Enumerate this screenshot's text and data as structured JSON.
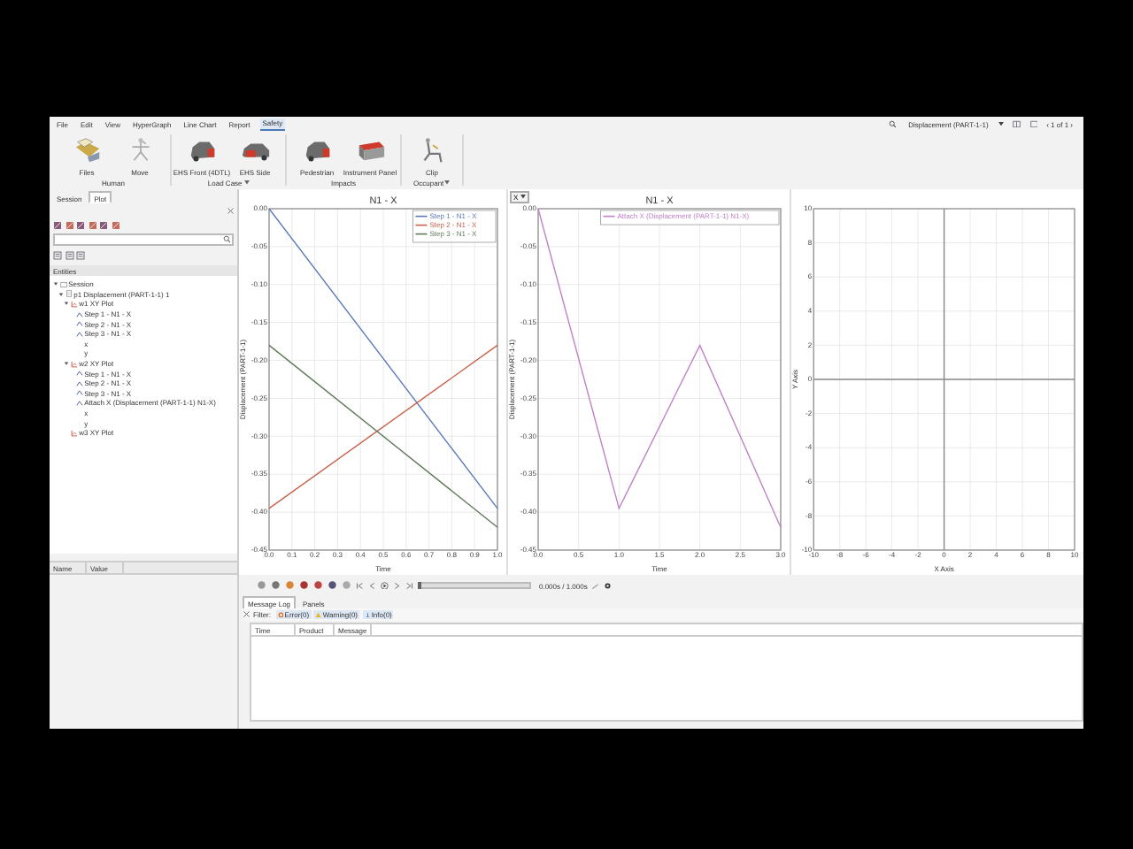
{
  "menu": {
    "items": [
      {
        "label": "File",
        "selected": false
      },
      {
        "label": "Edit",
        "selected": false
      },
      {
        "label": "View",
        "selected": false
      },
      {
        "label": "HyperGraph",
        "selected": false
      },
      {
        "label": "Line Chart",
        "selected": false
      },
      {
        "label": "Report",
        "selected": false
      },
      {
        "label": "Safety",
        "selected": true
      }
    ],
    "document": "Displacement (PART-1-1)",
    "pager": "‹ 1 of 1 ›"
  },
  "ribbon": {
    "groups": [
      {
        "label": "Human",
        "dropdown": false,
        "buttons": [
          {
            "label": "Files",
            "kind": "files"
          },
          {
            "label": "Move",
            "kind": "move"
          }
        ]
      },
      {
        "label": "Load Case",
        "dropdown": true,
        "buttons": [
          {
            "label": "EHS Front (4DTL)",
            "kind": "car_front"
          },
          {
            "label": "EHS Side",
            "kind": "car_side"
          }
        ]
      },
      {
        "label": "Impacts",
        "dropdown": false,
        "buttons": [
          {
            "label": "Pedestrian",
            "kind": "car_front"
          },
          {
            "label": "Instrument Panel",
            "kind": "panel"
          }
        ]
      },
      {
        "label": "Occupant",
        "dropdown": true,
        "buttons": [
          {
            "label": "Clip",
            "kind": "seat"
          }
        ]
      }
    ]
  },
  "sidebar": {
    "tabs": [
      {
        "label": "Session",
        "selected": false
      },
      {
        "label": "Plot",
        "selected": true
      }
    ],
    "entities_header": "Entities",
    "tree": [
      {
        "label": "Session",
        "kind": "session",
        "expanded": true,
        "children": [
          {
            "label": "p1 Displacement (PART-1-1) 1",
            "kind": "page",
            "expanded": true,
            "children": [
              {
                "label": "w1 XY Plot",
                "kind": "window",
                "expanded": true,
                "children": [
                  {
                    "label": "Step 1 - N1 - X",
                    "kind": "curve"
                  },
                  {
                    "label": "Step 2 - N1 - X",
                    "kind": "curve"
                  },
                  {
                    "label": "Step 3 - N1 - X",
                    "kind": "curve"
                  },
                  {
                    "label": "x",
                    "kind": "axis"
                  },
                  {
                    "label": "y",
                    "kind": "axis"
                  }
                ]
              },
              {
                "label": "w2 XY Plot",
                "kind": "window",
                "expanded": true,
                "children": [
                  {
                    "label": "Step 1 - N1 - X",
                    "kind": "curve"
                  },
                  {
                    "label": "Step 2 - N1 - X",
                    "kind": "curve"
                  },
                  {
                    "label": "Step 3 - N1 - X",
                    "kind": "curve"
                  },
                  {
                    "label": "Attach X (Displacement (PART-1-1) N1-X)",
                    "kind": "curve"
                  },
                  {
                    "label": "x",
                    "kind": "axis"
                  },
                  {
                    "label": "y",
                    "kind": "axis"
                  }
                ]
              },
              {
                "label": "w3 XY Plot",
                "kind": "window"
              }
            ]
          }
        ]
      }
    ],
    "properties_columns": [
      "Name",
      "Value"
    ]
  },
  "plots": [
    {
      "chart_data": {
        "type": "line",
        "grid": true,
        "legend": "upper right",
        "title": "N1 - X",
        "xlabel": "Time",
        "ylabel": "Displacement (PART-1-1)",
        "x": [
          0,
          1
        ],
        "series": [
          {
            "name": "Step 1 - N1 - X",
            "color": "#5a78b8",
            "values": [
              0,
              -0.395
            ]
          },
          {
            "name": "Step 2 - N1 - X",
            "color": "#c8604a",
            "values": [
              -0.395,
              -0.18
            ]
          },
          {
            "name": "Step 3 - N1 - X",
            "color": "#5f7a5a",
            "values": [
              -0.18,
              -0.42
            ]
          }
        ],
        "xlim": [
          0,
          1
        ],
        "ylim": [
          -0.45,
          0
        ],
        "xticks": [
          {
            "value": 0,
            "label": "0.0"
          },
          {
            "value": 0.1,
            "label": "0.1"
          },
          {
            "value": 0.2,
            "label": "0.2"
          },
          {
            "value": 0.3,
            "label": "0.3"
          },
          {
            "value": 0.4,
            "label": "0.4"
          },
          {
            "value": 0.5,
            "label": "0.5"
          },
          {
            "value": 0.6,
            "label": "0.6"
          },
          {
            "value": 0.7,
            "label": "0.7"
          },
          {
            "value": 0.8,
            "label": "0.8"
          },
          {
            "value": 0.9,
            "label": "0.9"
          },
          {
            "value": 1,
            "label": "1.0"
          }
        ],
        "yticks": [
          {
            "value": 0,
            "label": "0.00"
          },
          {
            "value": -0.05,
            "label": "-0.05"
          },
          {
            "value": -0.1,
            "label": "-0.10"
          },
          {
            "value": -0.15,
            "label": "-0.15"
          },
          {
            "value": -0.2,
            "label": "-0.20"
          },
          {
            "value": -0.25,
            "label": "-0.25"
          },
          {
            "value": -0.3,
            "label": "-0.30"
          },
          {
            "value": -0.35,
            "label": "-0.35"
          },
          {
            "value": -0.4,
            "label": "-0.40"
          },
          {
            "value": -0.45,
            "label": "-0.45"
          }
        ]
      }
    },
    {
      "axis_selector": {
        "label": "X"
      },
      "chart_data": {
        "type": "line",
        "grid": true,
        "legend": "upper right",
        "title": "N1 - X",
        "xlabel": "Time",
        "ylabel": "Displacement (PART-1-1)",
        "x": [
          0,
          1,
          2,
          3
        ],
        "series": [
          {
            "name": "Attach X (Displacement (PART-1-1) N1-X)",
            "color": "#c080c8",
            "values": [
              0,
              -0.395,
              -0.18,
              -0.42
            ]
          }
        ],
        "xlim": [
          0,
          3
        ],
        "ylim": [
          -0.45,
          0
        ],
        "xticks": [
          {
            "value": 0,
            "label": "0.0"
          },
          {
            "value": 0.5,
            "label": "0.5"
          },
          {
            "value": 1,
            "label": "1.0"
          },
          {
            "value": 1.5,
            "label": "1.5"
          },
          {
            "value": 2,
            "label": "2.0"
          },
          {
            "value": 2.5,
            "label": "2.5"
          },
          {
            "value": 3,
            "label": "3.0"
          }
        ],
        "yticks": [
          {
            "value": 0,
            "label": "0.00"
          },
          {
            "value": -0.05,
            "label": "-0.05"
          },
          {
            "value": -0.1,
            "label": "-0.10"
          },
          {
            "value": -0.15,
            "label": "-0.15"
          },
          {
            "value": -0.2,
            "label": "-0.20"
          },
          {
            "value": -0.25,
            "label": "-0.25"
          },
          {
            "value": -0.3,
            "label": "-0.30"
          },
          {
            "value": -0.35,
            "label": "-0.35"
          },
          {
            "value": -0.4,
            "label": "-0.40"
          },
          {
            "value": -0.45,
            "label": "-0.45"
          }
        ]
      }
    },
    {
      "chart_data": {
        "type": "line",
        "grid": true,
        "xlabel": "X Axis",
        "ylabel": "Y Axis",
        "xlim": [
          -10,
          10
        ],
        "ylim": [
          -10,
          10
        ],
        "xticks": [
          -10,
          -8,
          -6,
          -4,
          -2,
          0,
          2,
          4,
          6,
          8,
          10
        ],
        "yticks": [
          -10,
          -8,
          -6,
          -4,
          -2,
          0,
          2,
          4,
          6,
          8,
          10
        ]
      }
    }
  ],
  "playback": {
    "level": 0,
    "time": "0.000s / 1.000s"
  },
  "message_log": {
    "tabs": [
      {
        "label": "Message Log",
        "selected": true
      },
      {
        "label": "Panels",
        "selected": false
      }
    ],
    "filter_label": "Filter:",
    "filters": [
      {
        "kind": "error",
        "label": "Error(0)"
      },
      {
        "kind": "warning",
        "label": "Warning(0)"
      },
      {
        "kind": "info",
        "label": "Info(0)"
      }
    ],
    "columns": [
      "Time",
      "Product",
      "Message"
    ]
  }
}
